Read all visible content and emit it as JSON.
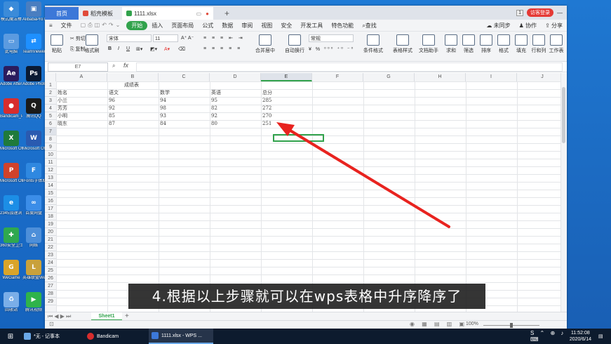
{
  "desktop_icons": [
    {
      "label": "模式魔法棒",
      "color": "#3b8bd9",
      "glyph": "◆"
    },
    {
      "label": "AlibabaProTr",
      "color": "#4a7ec0",
      "glyph": "▣"
    },
    {
      "label": "此电脑",
      "color": "#5b9be0",
      "glyph": "▭"
    },
    {
      "label": "TeamViewer",
      "color": "#1e90ff",
      "glyph": "⇄"
    },
    {
      "label": "Adobe After Effects 2020",
      "color": "#2b1c5e",
      "glyph": "Ae"
    },
    {
      "label": "Adobe Photoshop",
      "color": "#0a1a33",
      "glyph": "Ps"
    },
    {
      "label": "Bandicam_Portable",
      "color": "#d72d2d",
      "glyph": "●"
    },
    {
      "label": "腾讯QQ",
      "color": "#1a1a1a",
      "glyph": "Q"
    },
    {
      "label": "Microsoft Office Exc...",
      "color": "#1f7a3c",
      "glyph": "X"
    },
    {
      "label": "Microsoft Office Wo...",
      "color": "#2a5ab0",
      "glyph": "W"
    },
    {
      "label": "Microsoft Office Po...",
      "color": "#d0422b",
      "glyph": "P"
    },
    {
      "label": "iFonts字体助手",
      "color": "#2f88e0",
      "glyph": "F"
    },
    {
      "label": "2345加速浏览器",
      "color": "#1c8ee6",
      "glyph": "e"
    },
    {
      "label": "百度网盘",
      "color": "#3b8de8",
      "glyph": "∞"
    },
    {
      "label": "360安全卫士",
      "color": "#2fa84f",
      "glyph": "✚"
    },
    {
      "label": "网络",
      "color": "#4d8fd9",
      "glyph": "⌂"
    },
    {
      "label": "WeGame",
      "color": "#d9a42a",
      "glyph": "G"
    },
    {
      "label": "英雄联盟WeGame版",
      "color": "#c9a13b",
      "glyph": "L"
    },
    {
      "label": "回收站",
      "color": "#7aaee8",
      "glyph": "♻"
    },
    {
      "label": "腾讯视频",
      "color": "#2fb34a",
      "glyph": "▶"
    }
  ],
  "window": {
    "tabs": {
      "home": "首页",
      "template": "稻壳模板",
      "doc": "1111.xlsx"
    },
    "page_num": "1",
    "login": "访客登录"
  },
  "menu": {
    "file": "文件",
    "items": [
      "开始",
      "插入",
      "页面布局",
      "公式",
      "数据",
      "审阅",
      "视图",
      "安全",
      "开发工具",
      "特色功能"
    ],
    "search": "查找",
    "right": [
      "未同步",
      "协作",
      "分享"
    ]
  },
  "ribbon": {
    "paste": "粘贴",
    "cut": "剪切",
    "copy": "复制",
    "format_painter": "格式刷",
    "font_name": "宋体",
    "font_size": "11",
    "number_format": "常规",
    "merge": "合并居中",
    "wrap": "自动换行",
    "cond_format": "条件格式",
    "table_style": "表格样式",
    "doc_helper": "文档助手",
    "sum": "求和",
    "filter": "筛选",
    "sort": "排序",
    "format": "格式",
    "fill": "填充",
    "rowcol": "行和列",
    "worksheet": "工作表"
  },
  "formula_bar": {
    "name_box": "E7",
    "fx": "fx"
  },
  "columns": [
    "A",
    "B",
    "C",
    "D",
    "E",
    "F",
    "G",
    "H",
    "I",
    "J"
  ],
  "rows": [
    "1",
    "2",
    "3",
    "4",
    "5",
    "6",
    "7",
    "8",
    "9",
    "10",
    "11",
    "12",
    "13",
    "14",
    "15",
    "16",
    "17",
    "18",
    "19",
    "20",
    "21",
    "22",
    "23",
    "24",
    "25",
    "26",
    "27",
    "28",
    "29"
  ],
  "sheet": {
    "title": "成绩表",
    "header": [
      "姓名",
      "语文",
      "数学",
      "英语",
      "总分"
    ],
    "data": [
      [
        "小兰",
        "96",
        "94",
        "95",
        "285"
      ],
      [
        "芳芳",
        "92",
        "98",
        "82",
        "272"
      ],
      [
        "小明",
        "85",
        "93",
        "92",
        "270"
      ],
      [
        "晓东",
        "87",
        "84",
        "80",
        "251"
      ]
    ]
  },
  "sheet_tab": "Sheet1",
  "zoom": "100%",
  "caption": "4.根据以上步骤就可以在wps表格中升序降序了",
  "taskbar": {
    "items": [
      "*无 - 记事本",
      "Bandicam",
      "1111.xlsx - WPS ..."
    ],
    "time": "11:52:08",
    "date": "2020/6/14"
  },
  "colors": {
    "accent": "#31a24c",
    "wps_blue": "#3c78d8",
    "arrow_red": "#e8231f"
  }
}
